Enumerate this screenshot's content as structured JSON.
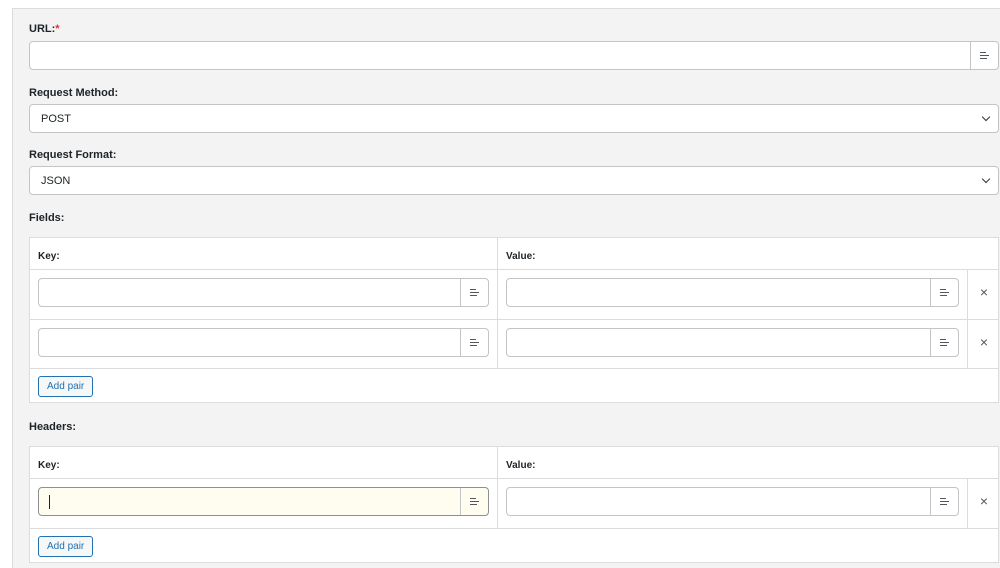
{
  "url": {
    "label": "URL:",
    "required_mark": "*",
    "value": ""
  },
  "request_method": {
    "label": "Request Method:",
    "selected": "POST"
  },
  "request_format": {
    "label": "Request Format:",
    "selected": "JSON"
  },
  "fields": {
    "label": "Fields:",
    "key_header": "Key:",
    "value_header": "Value:",
    "rows": [
      {
        "key": "",
        "value": ""
      },
      {
        "key": "",
        "value": ""
      }
    ],
    "add_label": "Add pair"
  },
  "headers": {
    "label": "Headers:",
    "key_header": "Key:",
    "value_header": "Value:",
    "rows": [
      {
        "key": "",
        "value": ""
      }
    ],
    "add_label": "Add pair"
  },
  "icons": {
    "field_addon": "text-lines-icon",
    "remove": "close-icon",
    "dropdown": "chevron-down-icon"
  },
  "colors": {
    "required": "#d63638",
    "button_accent": "#2271b1",
    "focused_field": "#fffdf0"
  }
}
